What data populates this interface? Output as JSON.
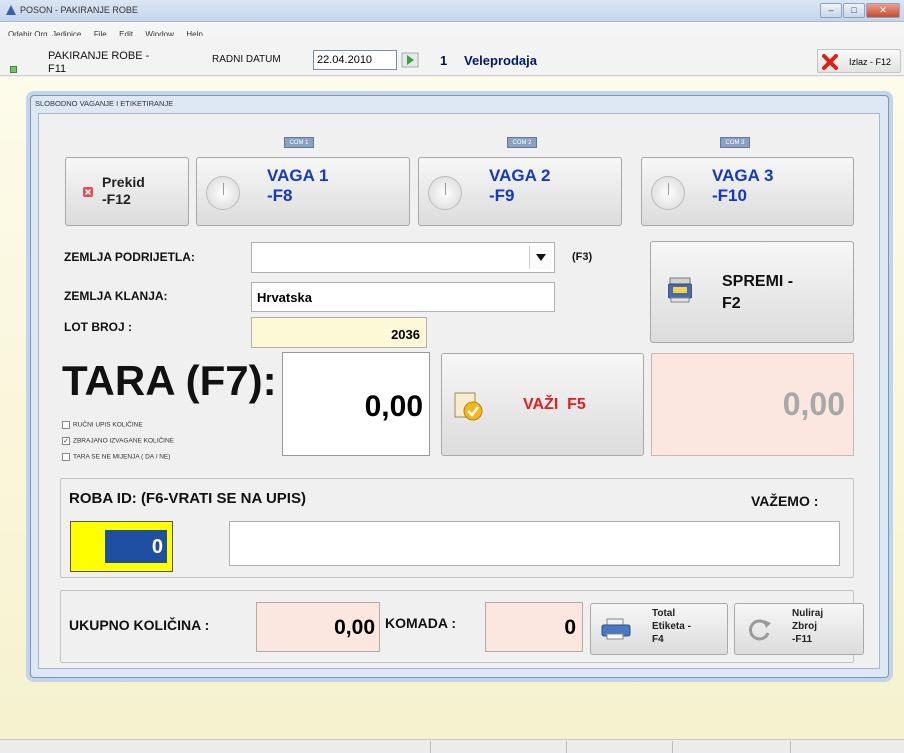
{
  "window": {
    "title": "POSON - PAKIRANJE ROBE",
    "min_label": "–",
    "max_label": "□",
    "close_label": "✕"
  },
  "menu": [
    "Odabir Org. Jedinice",
    "File",
    "Edit",
    "Window",
    "Help"
  ],
  "toolbar": {
    "pakiranje_line1": "PAKIRANJE ROBE -",
    "pakiranje_line2": "F11",
    "radni_datum_label": "RADNI DATUM",
    "radni_datum_value": "22.04.2010",
    "org_number": "1",
    "org_name": "Veleprodaja",
    "izlaz_label": "Izlaz - F12"
  },
  "dialog": {
    "title": "SLOBODNO VAGANJE I ETIKETIRANJE",
    "prekid": {
      "line1": "Prekid",
      "line2": "-F12"
    },
    "scales": [
      {
        "com": "COM 1",
        "line1": "VAGA 1",
        "line2": "-F8"
      },
      {
        "com": "COM 2",
        "line1": "VAGA 2",
        "line2": "-F9"
      },
      {
        "com": "COM 3",
        "line1": "VAGA 3",
        "line2": "-F10"
      }
    ],
    "zemlja_podrijetla_label": "ZEMLJA PODRIJETLA:",
    "zemlja_podrijetla_value": "",
    "zemlja_podrijetla_hint": "(F3)",
    "zemlja_klanja_label": "ZEMLJA KLANJA:",
    "zemlja_klanja_value": "Hrvatska",
    "lot_label": "LOT BROJ :",
    "lot_value": "2036",
    "spremi": {
      "line1": "SPREMI -",
      "line2": "F2"
    },
    "tara_label": "TARA (F7):",
    "tara_value": "0,00",
    "vazi_label": "VAŽI  F5",
    "weight_value": "0,00",
    "checkboxes": [
      {
        "label": "RUČNI UPIS KOLIČINE",
        "checked": false
      },
      {
        "label": "ZBRAJANO IZVAGANE KOLIČINE",
        "checked": true
      },
      {
        "label": "TARA SE NE MIJENJA ( DA / NE)",
        "checked": false
      }
    ],
    "roba_label": "ROBA ID: (F6-VRATI SE NA UPIS)",
    "vazemo_label": "VAŽEMO :",
    "roba_id_value": "0",
    "roba_name_value": "",
    "ukupno_label": "UKUPNO KOLIČINA  :",
    "ukupno_value": "0,00",
    "komada_label": "KOMADA :",
    "komada_value": "0",
    "total_etiketa": {
      "line1": "Total",
      "line2": "Etiketa -",
      "line3": "F4"
    },
    "nuliraj": {
      "line1": "Nuliraj",
      "line2": "Zbroj",
      "line3": "-F11"
    }
  },
  "colors": {
    "vaga_text": "#1438c2",
    "vazi_text": "#e02020",
    "lot_bg": "#fdf8d6",
    "readout_bg": "#fbe7df",
    "roba_id_bg": "#ffff00",
    "roba_id_inner": "#1f4fa0"
  }
}
